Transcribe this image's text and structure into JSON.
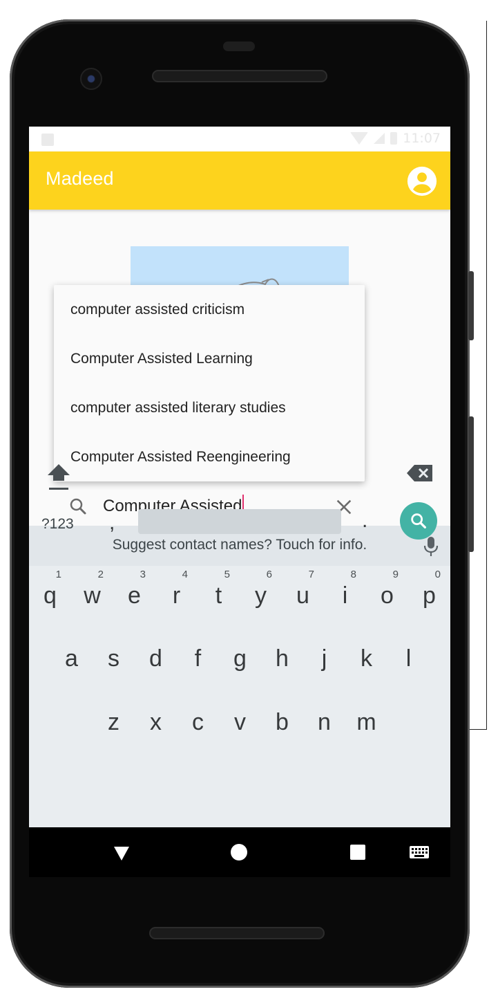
{
  "status_bar": {
    "time": "11:07"
  },
  "app_bar": {
    "title": "Madeed",
    "account_icon": "account-circle-icon",
    "color": "#fdd31d"
  },
  "autocomplete": {
    "suggestions": [
      "computer assisted criticism",
      "Computer Assisted Learning",
      "computer assisted literary studies",
      "Computer Assisted Reengineering"
    ]
  },
  "search": {
    "value": "Computer Assisted",
    "icon": "search-icon",
    "clear_icon": "close-icon",
    "caret_color": "#e0306d"
  },
  "keyboard": {
    "suggestion_text": "Suggest contact names? Touch for info.",
    "row1": [
      {
        "key": "q",
        "num": "1"
      },
      {
        "key": "w",
        "num": "2"
      },
      {
        "key": "e",
        "num": "3"
      },
      {
        "key": "r",
        "num": "4"
      },
      {
        "key": "t",
        "num": "5"
      },
      {
        "key": "y",
        "num": "6"
      },
      {
        "key": "u",
        "num": "7"
      },
      {
        "key": "i",
        "num": "8"
      },
      {
        "key": "o",
        "num": "9"
      },
      {
        "key": "p",
        "num": "0"
      }
    ],
    "row2": [
      "a",
      "s",
      "d",
      "f",
      "g",
      "h",
      "j",
      "k",
      "l"
    ],
    "row3": [
      "z",
      "x",
      "c",
      "v",
      "b",
      "n",
      "m"
    ],
    "symbols_label": "?123",
    "comma": ",",
    "period": ".",
    "enter_color": "#43b3a5"
  }
}
